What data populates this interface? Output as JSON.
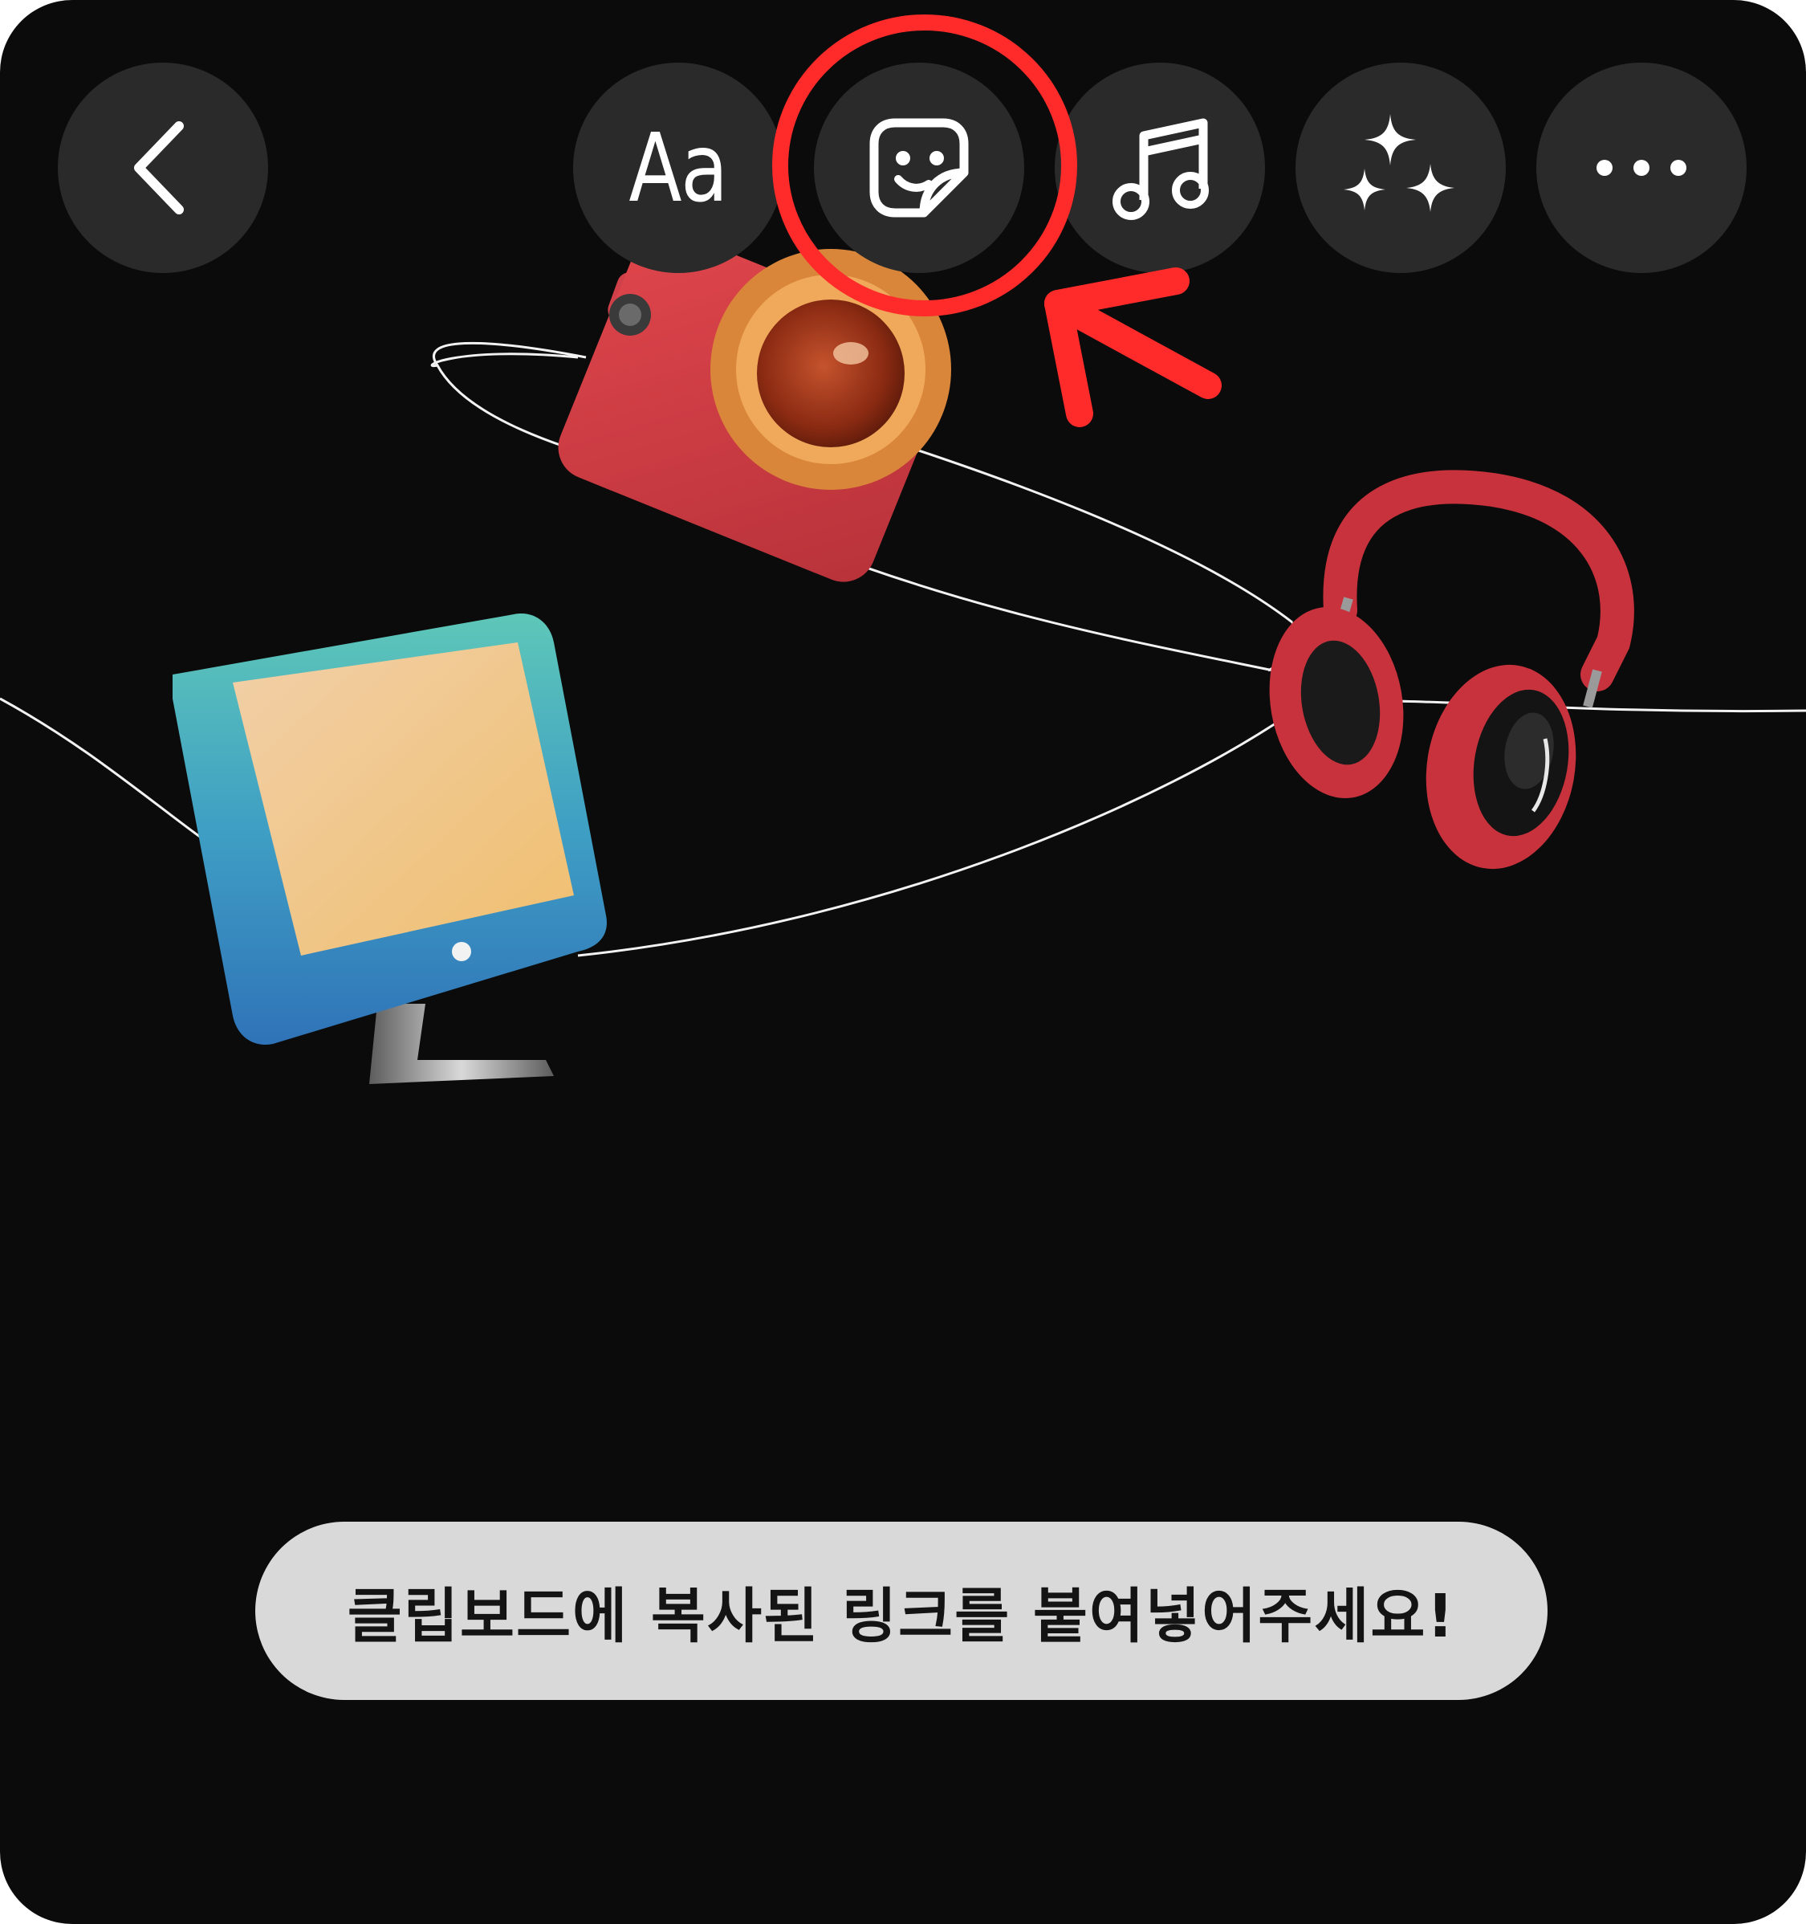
{
  "toolbar": {
    "back_icon": "chevron-left-icon",
    "text_label": "Aa",
    "sticker_icon": "sticker-smiley-icon",
    "music_icon": "music-note-icon",
    "effects_icon": "sparkles-icon",
    "more_icon": "more-horizontal-icon"
  },
  "annotation": {
    "color": "#ff2b2b",
    "highlight_target": "sticker-button"
  },
  "toast": {
    "message": "클립보드에 복사된 링크를 붙여넣어주세요!"
  },
  "colors": {
    "background": "#0b0b0b",
    "button_fill": "#2a2a2a",
    "toast_fill": "#d9d9d9"
  }
}
